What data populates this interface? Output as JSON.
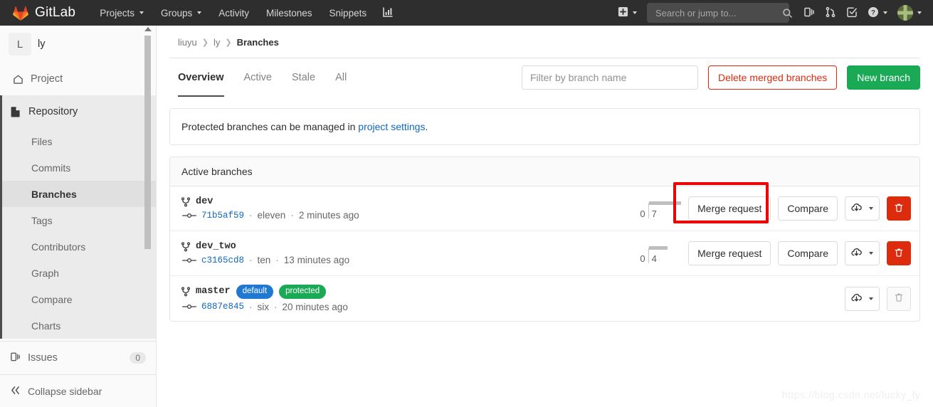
{
  "navbar": {
    "brand": "GitLab",
    "links": [
      {
        "label": "Projects",
        "icon": "chevron-down-icon",
        "has_caret": true
      },
      {
        "label": "Groups",
        "icon": "chevron-down-icon",
        "has_caret": true
      },
      {
        "label": "Activity",
        "has_caret": false
      },
      {
        "label": "Milestones",
        "has_caret": false
      },
      {
        "label": "Snippets",
        "has_caret": false
      }
    ],
    "analytics_icon": "chart-icon",
    "new_icon": "plus-square-icon",
    "search": {
      "placeholder": "Search or jump to...",
      "value": "",
      "icon": "search-icon"
    },
    "right_icons": [
      {
        "name": "issues-icon"
      },
      {
        "name": "merge-requests-icon"
      },
      {
        "name": "todos-icon"
      },
      {
        "name": "help-icon"
      }
    ],
    "avatar": "user-avatar"
  },
  "sidebar": {
    "project": {
      "initial": "L",
      "name": "ly"
    },
    "project_item": {
      "label": "Project",
      "icon": "home-icon"
    },
    "repository": {
      "label": "Repository",
      "icon": "file-icon",
      "items": [
        {
          "label": "Files",
          "active": false
        },
        {
          "label": "Commits",
          "active": false
        },
        {
          "label": "Branches",
          "active": true
        },
        {
          "label": "Tags",
          "active": false
        },
        {
          "label": "Contributors",
          "active": false
        },
        {
          "label": "Graph",
          "active": false
        },
        {
          "label": "Compare",
          "active": false
        },
        {
          "label": "Charts",
          "active": false
        }
      ]
    },
    "issues": {
      "label": "Issues",
      "count": "0",
      "icon": "issues-icon"
    },
    "collapse": {
      "label": "Collapse sidebar",
      "icon": "double-chevron-left-icon"
    }
  },
  "breadcrumb": {
    "group": "liuyu",
    "project": "ly",
    "current": "Branches"
  },
  "tabs": [
    {
      "label": "Overview",
      "active": true
    },
    {
      "label": "Active",
      "active": false
    },
    {
      "label": "Stale",
      "active": false
    },
    {
      "label": "All",
      "active": false
    }
  ],
  "toolbar": {
    "filter_placeholder": "Filter by branch name",
    "filter_value": "",
    "delete_merged_label": "Delete merged branches",
    "new_branch_label": "New branch"
  },
  "alert": {
    "text_before": "Protected branches can be managed in ",
    "link": "project settings",
    "text_after": "."
  },
  "panel": {
    "title": "Active branches"
  },
  "branches": [
    {
      "name": "dev",
      "badges": [],
      "sha": "71b5af59",
      "author": "eleven",
      "time": "2 minutes ago",
      "behind": "0",
      "ahead": "7",
      "ahead_bar_pct": 100,
      "merge_request_label": "Merge request",
      "compare_label": "Compare",
      "download_icon": "download-icon",
      "delete_enabled": true
    },
    {
      "name": "dev_two",
      "badges": [],
      "sha": "c3165cd8",
      "author": "ten",
      "time": "13 minutes ago",
      "behind": "0",
      "ahead": "4",
      "ahead_bar_pct": 57,
      "merge_request_label": "Merge request",
      "compare_label": "Compare",
      "download_icon": "download-icon",
      "delete_enabled": true
    },
    {
      "name": "master",
      "badges": [
        {
          "label": "default",
          "type": "default"
        },
        {
          "label": "protected",
          "type": "protected"
        }
      ],
      "sha": "6887e845",
      "author": "six",
      "time": "20 minutes ago",
      "behind": "",
      "ahead": "",
      "ahead_bar_pct": 0,
      "merge_request_label": "",
      "compare_label": "",
      "download_icon": "download-icon",
      "delete_enabled": false
    }
  ],
  "annotation": {
    "target": "merge-request-button-dev"
  },
  "watermark": "https://blog.csdn.net/lucky_ly",
  "colors": {
    "navbar_bg": "#2e2e2e",
    "accent_green": "#1aaa55",
    "accent_red": "#dd2b0e",
    "link_blue": "#1068bf",
    "badge_blue": "#1f78d1",
    "highlight_red": "#ee0000"
  }
}
